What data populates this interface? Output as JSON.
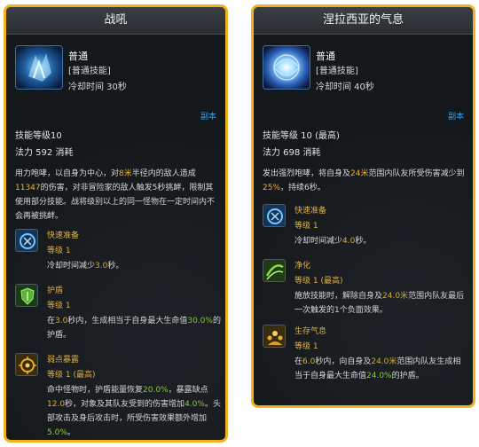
{
  "left_card": {
    "title": "战吼",
    "skill_name": "普通",
    "skill_type": "[普通技能]",
    "cooldown": "冷却时间 30秒",
    "link": "副本",
    "skill_level": "技能等级10",
    "mana": "法力 592 消耗",
    "desc": [
      {
        "t": "用力咆哮，以自身为中心，对"
      },
      {
        "t": "8米",
        "c": "y"
      },
      {
        "t": "半径内的敌人造成"
      },
      {
        "t": "11347",
        "c": "y"
      },
      {
        "t": "的伤害，对非冒险家的敌人触发5秒挑衅，限制其使用部分技能。战将级别以上的同一怪物在一定时间内不会再被挑衅。"
      }
    ],
    "talents": [
      {
        "name": "快速准备",
        "level": "等级 1",
        "icon": "quick-prep-icon",
        "text": [
          {
            "t": "冷却时间减少"
          },
          {
            "t": "3.0",
            "c": "y"
          },
          {
            "t": "秒。"
          }
        ]
      },
      {
        "name": "护盾",
        "level": "等级 1",
        "icon": "shield-icon",
        "text": [
          {
            "t": "在"
          },
          {
            "t": "3.0",
            "c": "y"
          },
          {
            "t": "秒内，生成相当于自身最大生命值"
          },
          {
            "t": "30.0%",
            "c": "g"
          },
          {
            "t": "的护盾。"
          }
        ]
      },
      {
        "name": "弱点暴露",
        "level": "等级 1 (最高)",
        "icon": "weakness-icon",
        "text": [
          {
            "t": "命中怪物时，护盾能量恢复"
          },
          {
            "t": "20.0%",
            "c": "g"
          },
          {
            "t": "，暴露缺点"
          },
          {
            "t": "12.0",
            "c": "y"
          },
          {
            "t": "秒，对象及其队友受到的伤害增加"
          },
          {
            "t": "4.0%",
            "c": "g"
          },
          {
            "t": "。头部攻击及身后攻击时，所受伤害效果额外增加"
          },
          {
            "t": "5.0%",
            "c": "g"
          },
          {
            "t": "。"
          }
        ]
      }
    ]
  },
  "right_card": {
    "title": "涅拉西亚的气息",
    "skill_name": "普通",
    "skill_type": "[普通技能]",
    "cooldown": "冷却时间 40秒",
    "link": "副本",
    "skill_level": "技能等级 10 (最高)",
    "mana": "法力 698 消耗",
    "desc": [
      {
        "t": "发出强烈咆哮，将自身及"
      },
      {
        "t": "24米",
        "c": "y"
      },
      {
        "t": "范围内队友所受伤害减少到"
      },
      {
        "t": "25%",
        "c": "y"
      },
      {
        "t": "，持续6秒。"
      }
    ],
    "talents": [
      {
        "name": "快速准备",
        "level": "等级 1",
        "icon": "quick-prep-icon",
        "text": [
          {
            "t": "冷却时间减少"
          },
          {
            "t": "4.0",
            "c": "y"
          },
          {
            "t": "秒。"
          }
        ]
      },
      {
        "name": "净化",
        "level": "等级 1 (最高)",
        "icon": "purify-icon",
        "text": [
          {
            "t": "施放技能时，解除自身及"
          },
          {
            "t": "24.0米",
            "c": "y"
          },
          {
            "t": "范围内队友最后一次触发的1个负面效果。"
          }
        ]
      },
      {
        "name": "生存气息",
        "level": "等级 1",
        "icon": "survival-icon",
        "text": [
          {
            "t": "在"
          },
          {
            "t": "6.0",
            "c": "y"
          },
          {
            "t": "秒内，向自身及"
          },
          {
            "t": "24.0米",
            "c": "y"
          },
          {
            "t": "范围内队友生成相当于自身最大生命值"
          },
          {
            "t": "24.0%",
            "c": "g"
          },
          {
            "t": "的护盾。"
          }
        ]
      }
    ]
  },
  "colors": {
    "border": "#f2b21f",
    "highlight_yellow": "#e6b533",
    "highlight_green": "#93d43b",
    "link": "#3aa0e8"
  }
}
